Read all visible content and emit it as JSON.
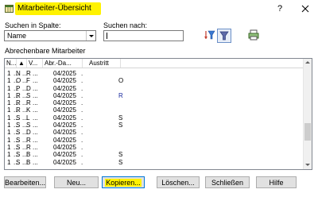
{
  "window": {
    "title": "Mitarbeiter-Übersicht",
    "help": "?",
    "close": "X"
  },
  "search": {
    "column_label": "Suchen in Spalte:",
    "column_value": "Name",
    "search_label": "Suchen nach:",
    "search_value": ""
  },
  "list": {
    "caption": "Abrechenbare Mitarbeiter",
    "headers": [
      "N...",
      "▲",
      "V...",
      "Abr.-Da...",
      "Austritt"
    ],
    "rows": [
      {
        "nr": "1",
        "vn": "N",
        "nn": "R",
        "abr": "04/2025",
        "austritt": ""
      },
      {
        "nr": "1",
        "vn": "O",
        "nn": "F",
        "abr": "04/2025",
        "austritt": "O"
      },
      {
        "nr": "1",
        "vn": "P",
        "nn": "D",
        "abr": "04/2025",
        "austritt": ""
      },
      {
        "nr": "1",
        "vn": "R",
        "nn": "S",
        "abr": "04/2025",
        "austritt": "R"
      },
      {
        "nr": "1",
        "vn": "R",
        "nn": "R",
        "abr": "04/2025",
        "austritt": ""
      },
      {
        "nr": "1",
        "vn": "R",
        "nn": "K",
        "abr": "04/2025",
        "austritt": ""
      },
      {
        "nr": "1",
        "vn": "S",
        "nn": "L",
        "abr": "04/2025",
        "austritt": "S"
      },
      {
        "nr": "1",
        "vn": "S",
        "nn": "S",
        "abr": "04/2025",
        "austritt": "S"
      },
      {
        "nr": "1",
        "vn": "S",
        "nn": "D",
        "abr": "04/2025",
        "austritt": ""
      },
      {
        "nr": "1",
        "vn": "S",
        "nn": "R",
        "abr": "04/2025",
        "austritt": ""
      },
      {
        "nr": "1",
        "vn": "S",
        "nn": "R",
        "abr": "04/2025",
        "austritt": ""
      },
      {
        "nr": "1",
        "vn": "S",
        "nn": "B",
        "abr": "04/2025",
        "austritt": "S"
      },
      {
        "nr": "1",
        "vn": "S",
        "nn": "B",
        "abr": "04/2025",
        "austritt": "S"
      }
    ]
  },
  "buttons": {
    "edit": "Bearbeiten...",
    "new": "Neu...",
    "copy": "Kopieren...",
    "delete": "Löschen...",
    "close": "Schließen",
    "help": "Hilfe"
  },
  "colors": {
    "highlight": "#fff200",
    "austritt_r": "#1a2a9e"
  },
  "icons": {
    "app": "table-window-icon",
    "sort_filter": "sort-filter-icon",
    "filter": "funnel-icon",
    "print": "printer-icon"
  }
}
